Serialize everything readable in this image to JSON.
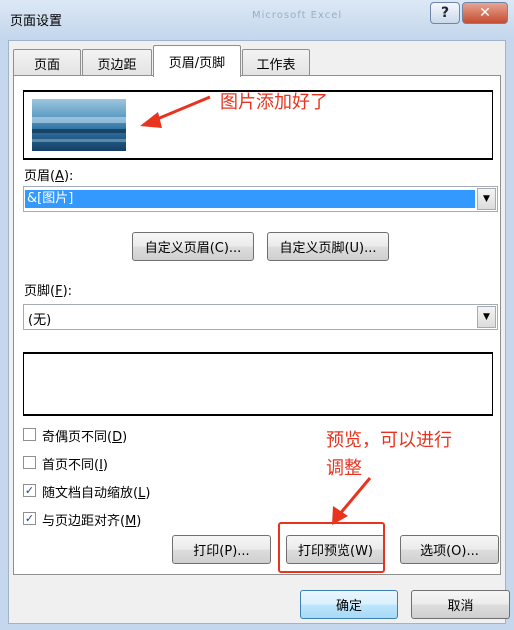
{
  "window": {
    "title": "页面设置",
    "ghost_title": "Microsoft Excel",
    "help_label": "?",
    "close_label": "✕"
  },
  "tabs": [
    {
      "label": "页面"
    },
    {
      "label": "页边距"
    },
    {
      "label": "页眉/页脚",
      "active": true
    },
    {
      "label": "工作表"
    }
  ],
  "header": {
    "label_prefix": "页眉(",
    "label_key": "A",
    "label_suffix": "):",
    "value": "&[图片]"
  },
  "buttons_mid": {
    "custom_header": "自定义页眉(C)...",
    "custom_footer": "自定义页脚(U)..."
  },
  "footer": {
    "label_prefix": "页脚(",
    "label_key": "F",
    "label_suffix": "):",
    "value": "(无)"
  },
  "options": [
    {
      "prefix": "奇偶页不同(",
      "key": "D",
      "suffix": ")",
      "checked": false
    },
    {
      "prefix": "首页不同(",
      "key": "I",
      "suffix": ")",
      "checked": false
    },
    {
      "prefix": "随文档自动缩放(",
      "key": "L",
      "suffix": ")",
      "checked": true
    },
    {
      "prefix": "与页边距对齐(",
      "key": "M",
      "suffix": ")",
      "checked": true
    }
  ],
  "actions": {
    "print": "打印(P)...",
    "print_preview": "打印预览(W)",
    "options": "选项(O)..."
  },
  "dialog": {
    "ok": "确定",
    "cancel": "取消"
  },
  "annotations": {
    "image_note": "图片添加好了",
    "preview_note_line1": "预览，可以进行",
    "preview_note_line2": "调整",
    "color": "#e8331f"
  }
}
